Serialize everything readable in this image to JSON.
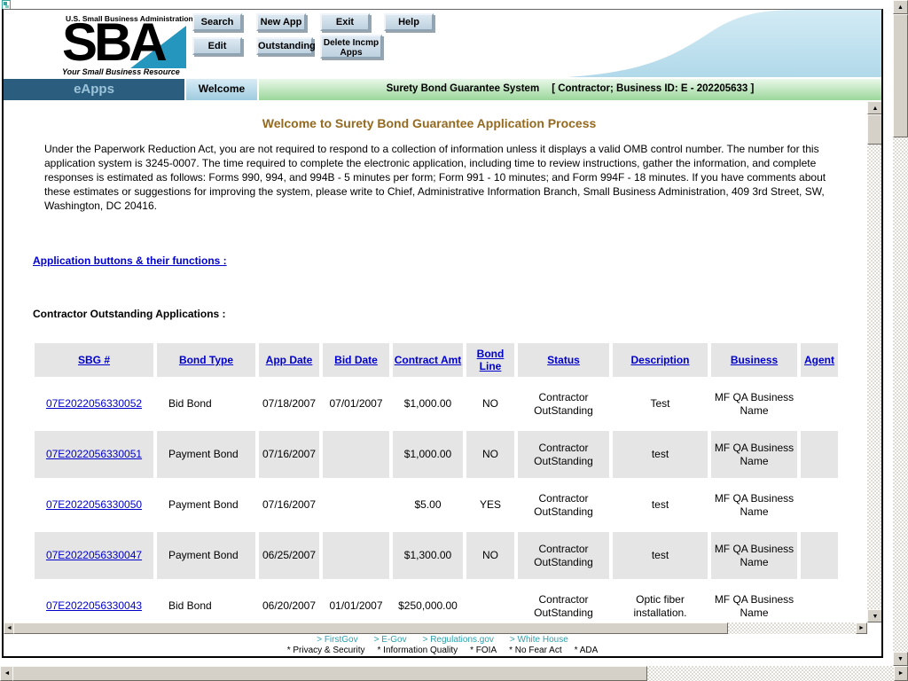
{
  "header": {
    "agency_line": "U.S. Small Business Administration",
    "logo_text": "SBA",
    "tagline": "Your Small Business Resource",
    "buttons_row1": [
      "Search",
      "New App",
      "Exit",
      "Help"
    ],
    "buttons_row2": [
      "Edit",
      "Outstanding",
      "Delete Incmp Apps"
    ]
  },
  "navbar": {
    "brand": "eApps",
    "tab": "Welcome",
    "system_title": "Surety Bond Guarantee System",
    "session_info": "[ Contractor;  Business ID: E - 202205633 ]"
  },
  "content": {
    "heading": "Welcome to Surety Bond Guarantee Application Process",
    "omb_notice": "Under the Paperwork Reduction Act, you are not required to respond to a collection of information unless it displays a valid OMB control number. The number for this application system is 3245-0007. The time required to complete the electronic application, including time to review instructions, gather the information, and complete responses is estimated as follows: Forms 990, 994, and 994B - 5 minutes per form; Form 991 - 10 minutes; and Form 994F - 18 minutes. If you have comments about these estimates or suggestions for improving the system, please write to Chief, Administrative Information Branch, Small Business Administration, 409 3rd Street, SW, Washington, DC 20416.",
    "functions_link": "Application buttons & their functions :",
    "table_title": "Contractor Outstanding Applications :",
    "table": {
      "columns": [
        "SBG #",
        "Bond Type",
        "App Date",
        "Bid Date",
        "Contract Amt",
        "Bond Line",
        "Status",
        "Description",
        "Business",
        "Agent"
      ],
      "rows": [
        {
          "sbg": "07E2022056330052",
          "bond_type": "Bid Bond",
          "app_date": "07/18/2007",
          "bid_date": "07/01/2007",
          "contract_amt": "$1,000.00",
          "bond_line": "NO",
          "status": "Contractor OutStanding",
          "description": "Test",
          "business": "MF QA Business Name",
          "agent": ""
        },
        {
          "sbg": "07E2022056330051",
          "bond_type": "Payment Bond",
          "app_date": "07/16/2007",
          "bid_date": "",
          "contract_amt": "$1,000.00",
          "bond_line": "NO",
          "status": "Contractor OutStanding",
          "description": "test",
          "business": "MF QA Business Name",
          "agent": ""
        },
        {
          "sbg": "07E2022056330050",
          "bond_type": "Payment Bond",
          "app_date": "07/16/2007",
          "bid_date": "",
          "contract_amt": "$5.00",
          "bond_line": "YES",
          "status": "Contractor OutStanding",
          "description": "test",
          "business": "MF QA Business Name",
          "agent": ""
        },
        {
          "sbg": "07E2022056330047",
          "bond_type": "Payment Bond",
          "app_date": "06/25/2007",
          "bid_date": "",
          "contract_amt": "$1,300.00",
          "bond_line": "NO",
          "status": "Contractor OutStanding",
          "description": "test",
          "business": "MF QA Business Name",
          "agent": ""
        },
        {
          "sbg": "07E2022056330043",
          "bond_type": "Bid Bond",
          "app_date": "06/20/2007",
          "bid_date": "01/01/2007",
          "contract_amt": "$250,000.00",
          "bond_line": "",
          "status": "Contractor OutStanding",
          "description": "Optic fiber installation.",
          "business": "MF QA Business Name",
          "agent": ""
        }
      ]
    }
  },
  "footer": {
    "gov_link_prefix": ">",
    "gov_links": [
      "FirstGov",
      "E-Gov",
      "Regulations.gov",
      "White House"
    ],
    "policy_link_prefix": "*",
    "policy_links": [
      "Privacy & Security",
      "Information Quality",
      "FOIA",
      "No Fear Act",
      "ADA"
    ]
  },
  "icons": {
    "scroll_up": "▲",
    "scroll_down": "▼",
    "scroll_left": "◄",
    "scroll_right": "►"
  },
  "colors": {
    "navbar_blue": "#2b5d7e",
    "tab_blue": "#9fcbdf",
    "title_green": "#9bd69b",
    "heading_brown": "#946a20",
    "link_blue": "#0000cc",
    "footer_teal": "#2ba0ad",
    "button_face": "#c9d8e6",
    "logo_swoosh_blue": "#2596be"
  }
}
